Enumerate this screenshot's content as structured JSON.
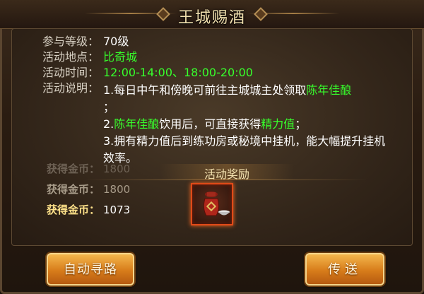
{
  "window": {
    "title": "王城赐酒"
  },
  "info": {
    "level_label": "参与等级：",
    "level_value": "70级",
    "location_label": "活动地点：",
    "location_value": "比奇城",
    "time_label": "活动时间：",
    "time_value": "12:00-14:00、18:00-20:00",
    "desc_label": "活动说明："
  },
  "description": {
    "line1_prefix": "1.每日中午和傍晚可前往主城城主处领取",
    "line1_item": "陈年佳酿",
    "line1_end": "；",
    "line2_item": "陈年佳酿",
    "line2_mid": "饮用后，可直接获得",
    "line2_reward": "精力值",
    "line2_end": "；",
    "line3": "3.拥有精力值后到练功房或秘境中挂机，能大幅提升挂机效率。"
  },
  "reward": {
    "title": "活动奖励",
    "item_icon": "wine-jar-icon",
    "item_name": "陈年佳酿"
  },
  "gold_log": [
    {
      "label": "获得金币：",
      "value": "1800"
    },
    {
      "label": "获得金币：",
      "value": "1800"
    },
    {
      "label": "获得金币：",
      "value": "1073"
    }
  ],
  "buttons": {
    "auto_path": "自动寻路",
    "teleport": "传送"
  },
  "colors": {
    "highlight_green": "#37ff2c",
    "button_orange": "#d77c1a",
    "item_border": "#e04a18"
  }
}
